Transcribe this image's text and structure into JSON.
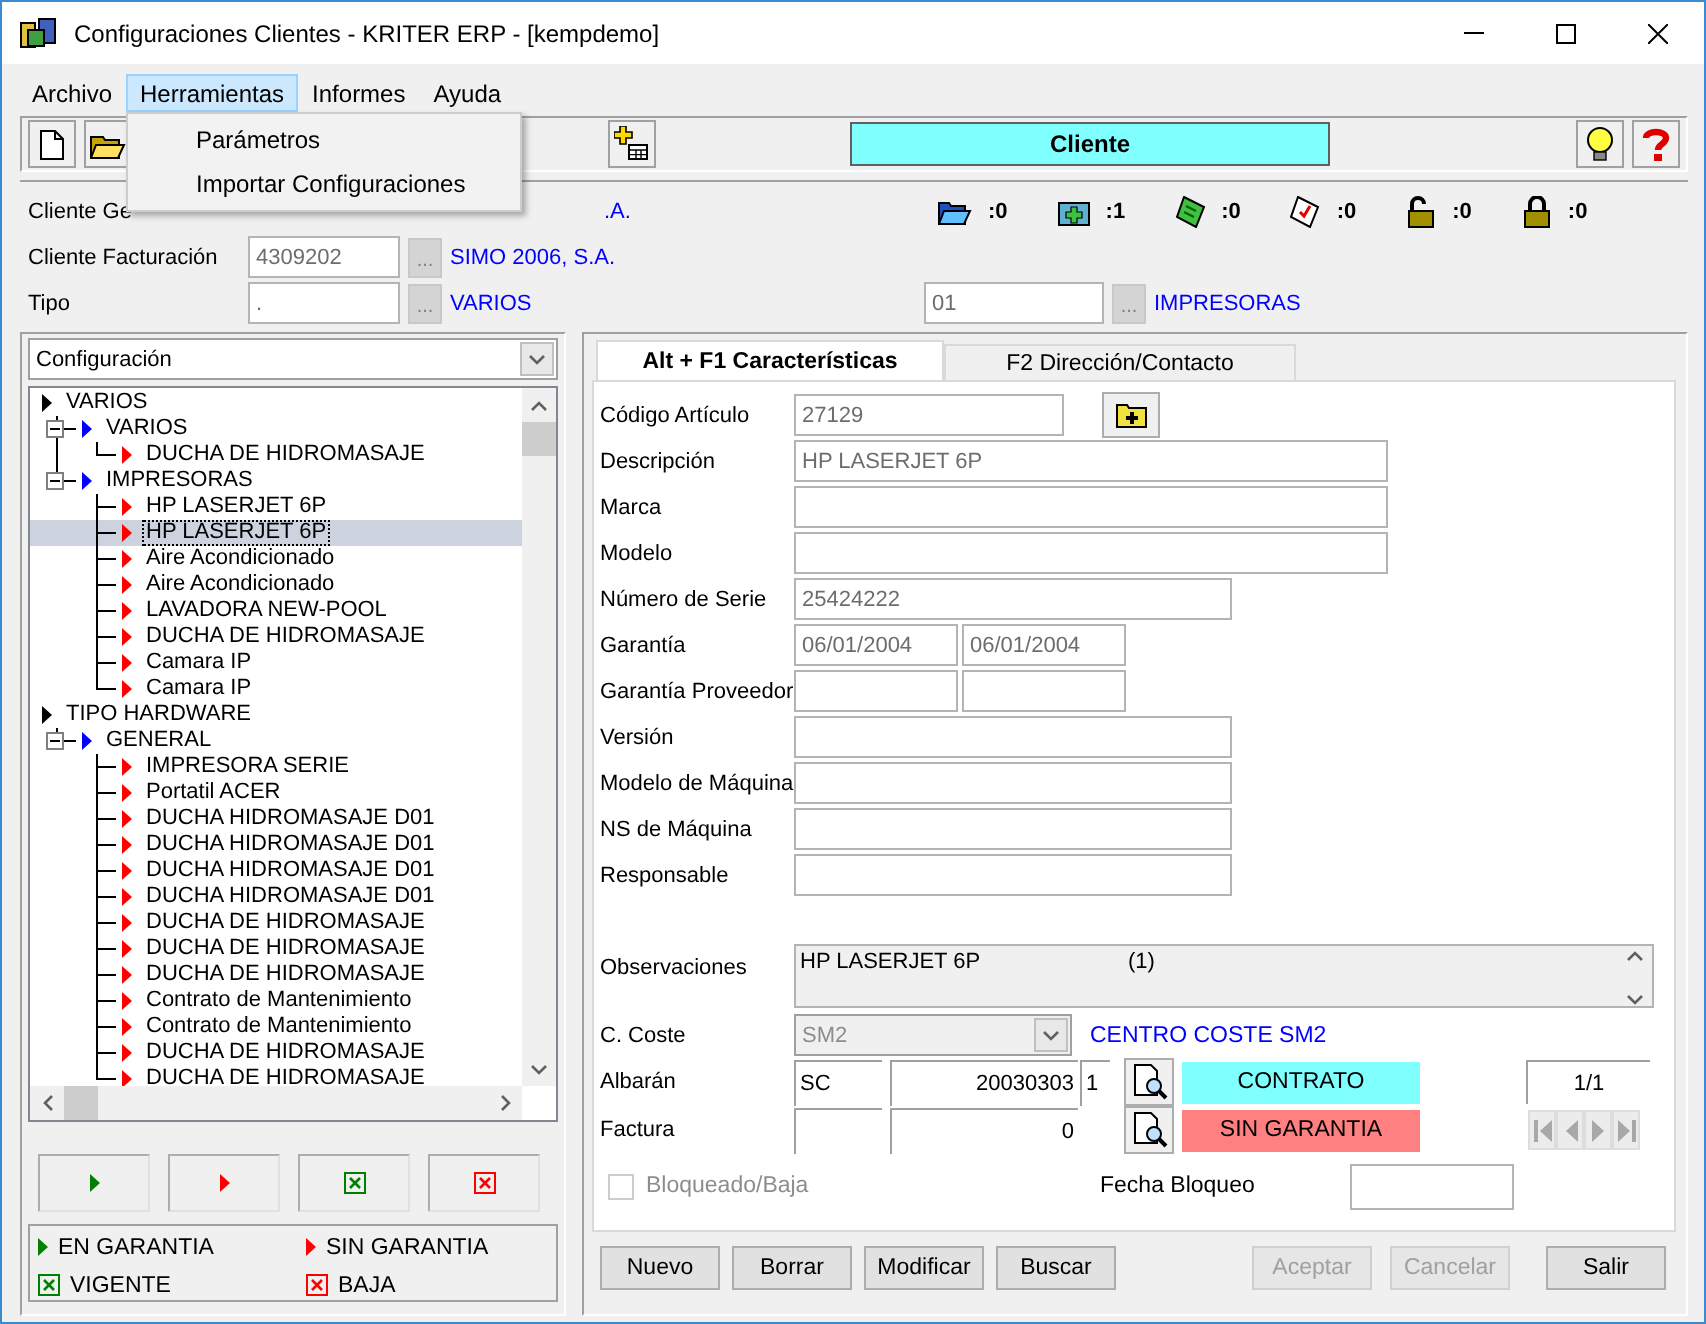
{
  "window": {
    "title": "Configuraciones Clientes - KRITER ERP - [kempdemo]"
  },
  "menu": [
    {
      "label": "Archivo",
      "selected": false
    },
    {
      "label": "Herramientas",
      "selected": true
    },
    {
      "label": "Informes",
      "selected": false
    },
    {
      "label": "Ayuda",
      "selected": false
    }
  ],
  "dropdown": [
    "Parámetros",
    "Importar Configuraciones"
  ],
  "toolbar": {
    "left": [
      {
        "kind": "new"
      },
      {
        "kind": "open"
      },
      {
        "kind": "add-table"
      }
    ],
    "banner": "Cliente",
    "right": [
      {
        "kind": "bulb"
      },
      {
        "kind": "help"
      }
    ]
  },
  "header": {
    "rows": [
      {
        "label": "Cliente Ge",
        "name": ".A.",
        "covered": true
      },
      {
        "label": "Cliente Facturación",
        "value": "4309202",
        "lookup": "...",
        "name": "SIMO 2006, S.A."
      },
      {
        "label": "Tipo",
        "value": ".",
        "lookup": "...",
        "name": "VARIOS"
      }
    ],
    "counts": [
      {
        "kind": "folder-open",
        "text": ":0"
      },
      {
        "kind": "folder-plus",
        "text": ":1"
      },
      {
        "kind": "note-green",
        "text": ":0"
      },
      {
        "kind": "note-check",
        "text": ":0"
      },
      {
        "kind": "lock-open",
        "text": ":0"
      },
      {
        "kind": "lock-closed",
        "text": ":0"
      }
    ],
    "subtype": {
      "value": "01",
      "lookup": "...",
      "name": "IMPRESORAS"
    }
  },
  "view_selector": "Configuración",
  "tree": [
    {
      "label": "VARIOS",
      "selected": false,
      "children": [
        {
          "label": "VARIOS",
          "selected": false,
          "expanded": true,
          "children": [
            {
              "label": "DUCHA DE HIDROMASAJE",
              "selected": false,
              "in_warranty": false
            }
          ]
        },
        {
          "label": "IMPRESORAS",
          "selected": false,
          "expanded": true,
          "children": [
            {
              "label": "HP LASERJET 6P",
              "selected": false,
              "in_warranty": false
            },
            {
              "label": "HP LASERJET 6P",
              "selected": true,
              "in_warranty": false
            },
            {
              "label": "Aire Acondicionado",
              "selected": false,
              "in_warranty": false
            },
            {
              "label": "Aire Acondicionado",
              "selected": false,
              "in_warranty": false
            },
            {
              "label": "LAVADORA NEW-POOL",
              "selected": false,
              "in_warranty": false
            },
            {
              "label": "DUCHA DE HIDROMASAJE",
              "selected": false,
              "in_warranty": false
            },
            {
              "label": "Camara IP",
              "selected": false,
              "in_warranty": false
            },
            {
              "label": "Camara IP",
              "selected": false,
              "in_warranty": false
            }
          ]
        }
      ]
    },
    {
      "label": "TIPO HARDWARE",
      "selected": false,
      "children": [
        {
          "label": "GENERAL",
          "selected": false,
          "expanded": true,
          "children": [
            {
              "label": "IMPRESORA SERIE",
              "selected": false,
              "in_warranty": false
            },
            {
              "label": "Portatil ACER",
              "selected": false,
              "in_warranty": false
            },
            {
              "label": "DUCHA HIDROMASAJE D01",
              "selected": false,
              "in_warranty": false
            },
            {
              "label": "DUCHA HIDROMASAJE D01",
              "selected": false,
              "in_warranty": false
            },
            {
              "label": "DUCHA HIDROMASAJE D01",
              "selected": false,
              "in_warranty": false
            },
            {
              "label": "DUCHA HIDROMASAJE D01",
              "selected": false,
              "in_warranty": false
            },
            {
              "label": "DUCHA DE HIDROMASAJE",
              "selected": false,
              "in_warranty": false
            },
            {
              "label": "DUCHA DE HIDROMASAJE",
              "selected": false,
              "in_warranty": false
            },
            {
              "label": "DUCHA DE HIDROMASAJE",
              "selected": false,
              "in_warranty": false
            },
            {
              "label": "Contrato de Mantenimiento",
              "selected": false,
              "in_warranty": false
            },
            {
              "label": "Contrato de Mantenimiento",
              "selected": false,
              "in_warranty": false
            },
            {
              "label": "DUCHA DE HIDROMASAJE",
              "selected": false,
              "in_warranty": false
            },
            {
              "label": "DUCHA DE HIDROMASAJE",
              "selected": false,
              "in_warranty": false
            }
          ]
        }
      ]
    }
  ],
  "filter_buttons": [
    {
      "kind": "triangle",
      "color": "#008000"
    },
    {
      "kind": "triangle",
      "color": "#ff0000"
    },
    {
      "kind": "crossbox",
      "color": "#008000"
    },
    {
      "kind": "crossbox",
      "color": "#ff0000"
    }
  ],
  "legend": [
    {
      "kind": "triangle",
      "color": "#008000",
      "label": "EN GARANTIA"
    },
    {
      "kind": "triangle",
      "color": "#ff0000",
      "label": "SIN GARANTIA"
    },
    {
      "kind": "crossbox",
      "color": "#008000",
      "label": "VIGENTE"
    },
    {
      "kind": "crossbox",
      "color": "#ff0000",
      "label": "BAJA"
    }
  ],
  "tabs": [
    {
      "label": "Alt + F1 Características",
      "selected": true
    },
    {
      "label": "F2 Dirección/Contacto",
      "selected": false
    }
  ],
  "form": {
    "rows": [
      {
        "label": "Código Artículo",
        "values": [
          "27129"
        ],
        "has_button": true
      },
      {
        "label": "Descripción",
        "values": [
          "HP LASERJET 6P"
        ]
      },
      {
        "label": "Marca"
      },
      {
        "label": "Modelo"
      },
      {
        "label": "Número de Serie",
        "values": [
          "25424222"
        ]
      },
      {
        "label": "Garantía",
        "values": [
          "06/01/2004",
          "06/01/2004"
        ]
      },
      {
        "label": "Garantía Proveedor"
      },
      {
        "label": "Versión"
      },
      {
        "label": "Modelo de Máquina"
      },
      {
        "label": "NS de Máquina"
      },
      {
        "label": "Responsable"
      }
    ],
    "observations": {
      "label": "Observaciones",
      "text": "HP LASERJET 6P",
      "note": "(1)"
    },
    "cost_center": {
      "label": "C. Coste",
      "value": "SM2",
      "disabled": true,
      "description": "CENTRO COSTE SM2"
    },
    "documents": [
      {
        "label": "Albarán",
        "series": "SC",
        "number": "20030303",
        "line": "1",
        "status": {
          "label": "CONTRATO",
          "color": "#80ffff"
        }
      },
      {
        "label": "Factura",
        "number": "0",
        "status": {
          "label": "SIN GARANTIA",
          "color": "#ff8080"
        }
      }
    ],
    "record": {
      "position": "1/1",
      "nav_disabled": true
    },
    "blocked": {
      "label": "Bloqueado/Baja",
      "checked": false,
      "disabled": true
    },
    "block_date": {
      "label": "Fecha Bloqueo"
    }
  },
  "buttons": {
    "left": [
      {
        "label": "Nuevo",
        "disabled": false
      },
      {
        "label": "Borrar",
        "disabled": false
      },
      {
        "label": "Modificar",
        "disabled": false
      },
      {
        "label": "Buscar",
        "disabled": false
      }
    ],
    "middle": [
      {
        "label": "Aceptar",
        "disabled": true
      },
      {
        "label": "Cancelar",
        "disabled": true
      }
    ],
    "right": [
      {
        "label": "Salir",
        "disabled": false
      }
    ]
  }
}
